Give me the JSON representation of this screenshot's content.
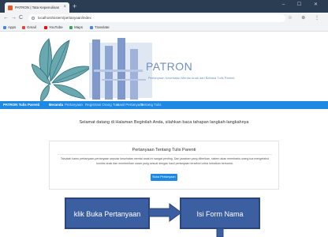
{
  "browser": {
    "tab_title": "PATRON | Tata Kepenulisan",
    "tab_close": "×",
    "new_tab": "+",
    "window_controls": "– ☐ ✕",
    "back": "←",
    "forward": "→",
    "reload": "C",
    "url": "localhost/sistem/pertanyaan/index",
    "toolbar_icons": "☆ ⊕ ⋮",
    "bookmarks": [
      {
        "label": "Apps",
        "color": "#4285f4"
      },
      {
        "label": "Gmail",
        "color": "#ea4335"
      },
      {
        "label": "YouTube",
        "color": "#ff0000"
      },
      {
        "label": "Maps",
        "color": "#34a853"
      },
      {
        "label": "Translate",
        "color": "#4285f4"
      }
    ]
  },
  "header": {
    "brand": "PATRON",
    "tagline": "Pertanyaan Kesehatan Mental Anak dari Bahasa Tulis Parenti"
  },
  "nav": {
    "items": [
      {
        "label": "PATRON Tulis Parenti",
        "active": true
      },
      {
        "label": "Beranda",
        "active": true
      },
      {
        "label": "Pertanyaan",
        "active": false
      },
      {
        "label": "Registrasi Orang Tua",
        "active": false
      },
      {
        "label": "Hasil Pertanyaan",
        "active": false
      },
      {
        "label": "Tentang Tulis",
        "active": false
      }
    ]
  },
  "content": {
    "welcome": "Selamat datang di Halaman Beginilah Anda, silahkan baca tahapan langkah-langkahnya",
    "card_title": "Pertanyaan Tentang Tulis Parenti",
    "card_text": "Tahukah kamu pertanyaan-pertanyaan seputar kesehatan mental anak ini sangat penting. Dari jawaban yang diberikan, sistem akan membantu orang tua mengetahui kondisi anak dan memberikan saran yang sesuai dengan hasil pertanyaan tersebut untuk kebaikan bersama.",
    "card_button": "Buka Pertanyaan"
  },
  "flow": {
    "step1": "klik Buka Pertanyaan",
    "step2": "Isi Form Nama"
  },
  "colors": {
    "navbar": "#1e88e5",
    "brand": "#6d8fc4",
    "flow_box": "#3b5fa0"
  }
}
